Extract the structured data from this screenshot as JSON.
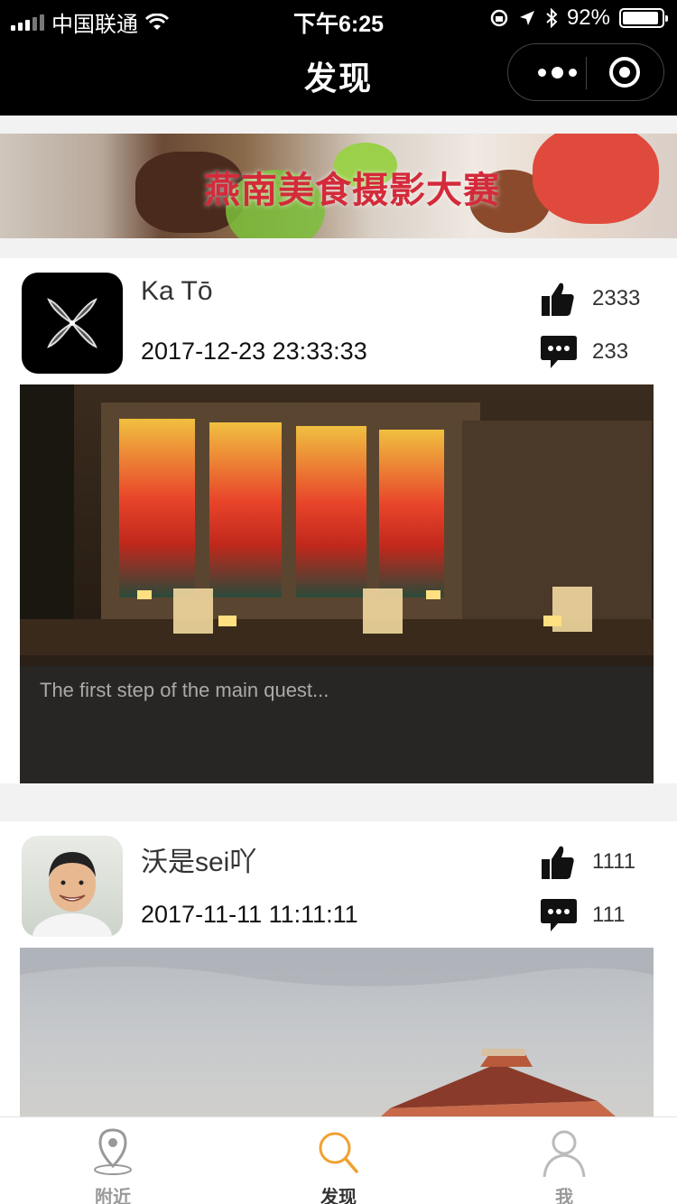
{
  "status_bar": {
    "carrier": "中国联通",
    "time": "下午6:25",
    "battery": "92%",
    "battery_level": 0.92
  },
  "nav": {
    "title": "发现"
  },
  "banner": {
    "title": "燕南美食摄影大赛"
  },
  "posts": [
    {
      "name": "Ka Tō",
      "date": "2017-12-23 23:33:33",
      "likes": "2333",
      "comments": "233",
      "caption": "The first step of the main quest..."
    },
    {
      "name": "沃是sei吖",
      "date": "2017-11-11 11:11:11",
      "likes": "1111",
      "comments": "111"
    }
  ],
  "tabbar": {
    "items": [
      {
        "label": "附近",
        "icon": "location-pin-icon"
      },
      {
        "label": "发现",
        "icon": "search-icon",
        "active": true
      },
      {
        "label": "我",
        "icon": "person-icon"
      }
    ]
  },
  "colors": {
    "accent": "#f0a030",
    "banner_title": "#d42a3a"
  }
}
